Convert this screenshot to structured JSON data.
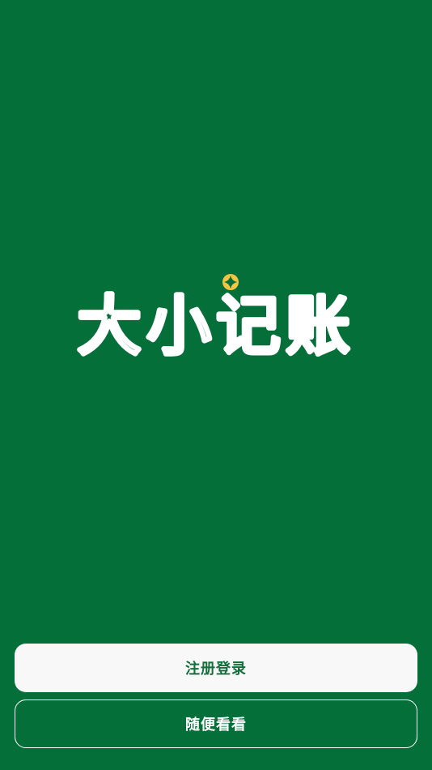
{
  "app": {
    "logo_text": "大小记账",
    "brand_color": "#056f3a",
    "sparkle_color": "#f4c542"
  },
  "actions": {
    "register_login_label": "注册登录",
    "browse_label": "随便看看"
  }
}
